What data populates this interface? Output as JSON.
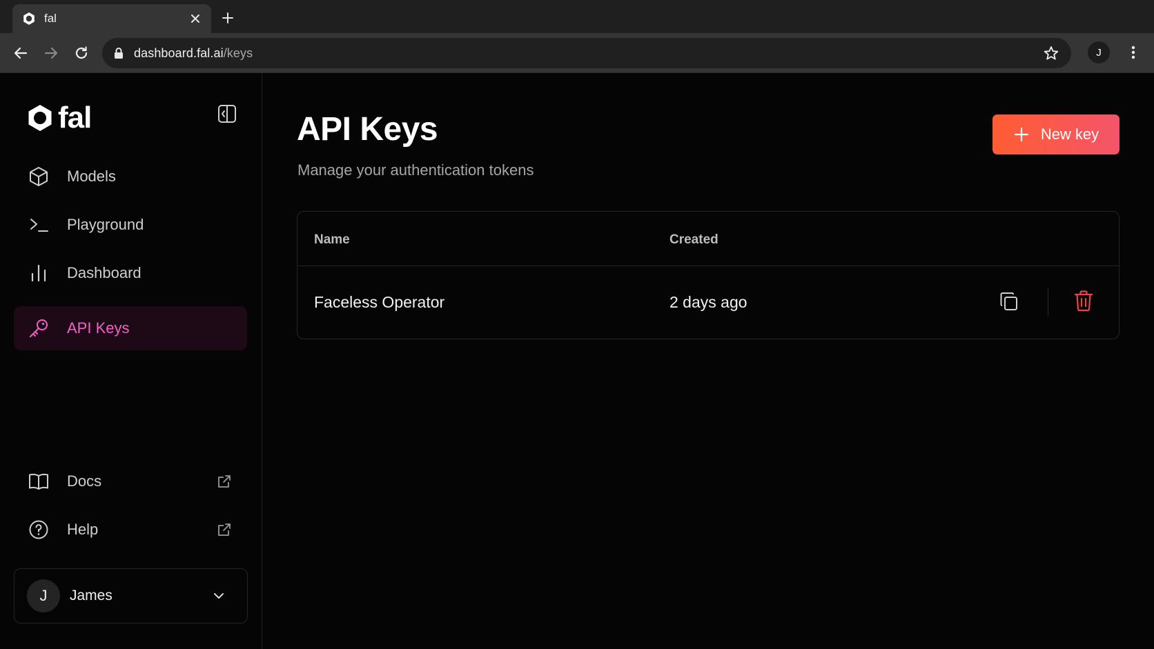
{
  "browser": {
    "tab_title": "fal",
    "url_host": "dashboard.fal.ai",
    "url_path": "/keys",
    "profile_initial": "J"
  },
  "sidebar": {
    "logo_text": "fal",
    "nav": [
      {
        "label": "Models",
        "icon": "cube-icon"
      },
      {
        "label": "Playground",
        "icon": "terminal-icon"
      },
      {
        "label": "Dashboard",
        "icon": "bar-chart-icon"
      },
      {
        "label": "API Keys",
        "icon": "key-icon",
        "active": true
      }
    ],
    "footer_links": [
      {
        "label": "Docs",
        "icon": "book-icon"
      },
      {
        "label": "Help",
        "icon": "help-circle-icon"
      }
    ],
    "user": {
      "initial": "J",
      "name": "James"
    }
  },
  "main": {
    "title": "API Keys",
    "subtitle": "Manage your authentication tokens",
    "new_key_label": "New key",
    "table": {
      "columns": [
        "Name",
        "Created"
      ],
      "rows": [
        {
          "name": "Faceless Operator",
          "created": "2 days ago"
        }
      ]
    }
  },
  "colors": {
    "accent": "#f062c8",
    "button_gradient_start": "#ff5c33",
    "button_gradient_end": "#f4556a",
    "danger": "#ef4444"
  }
}
